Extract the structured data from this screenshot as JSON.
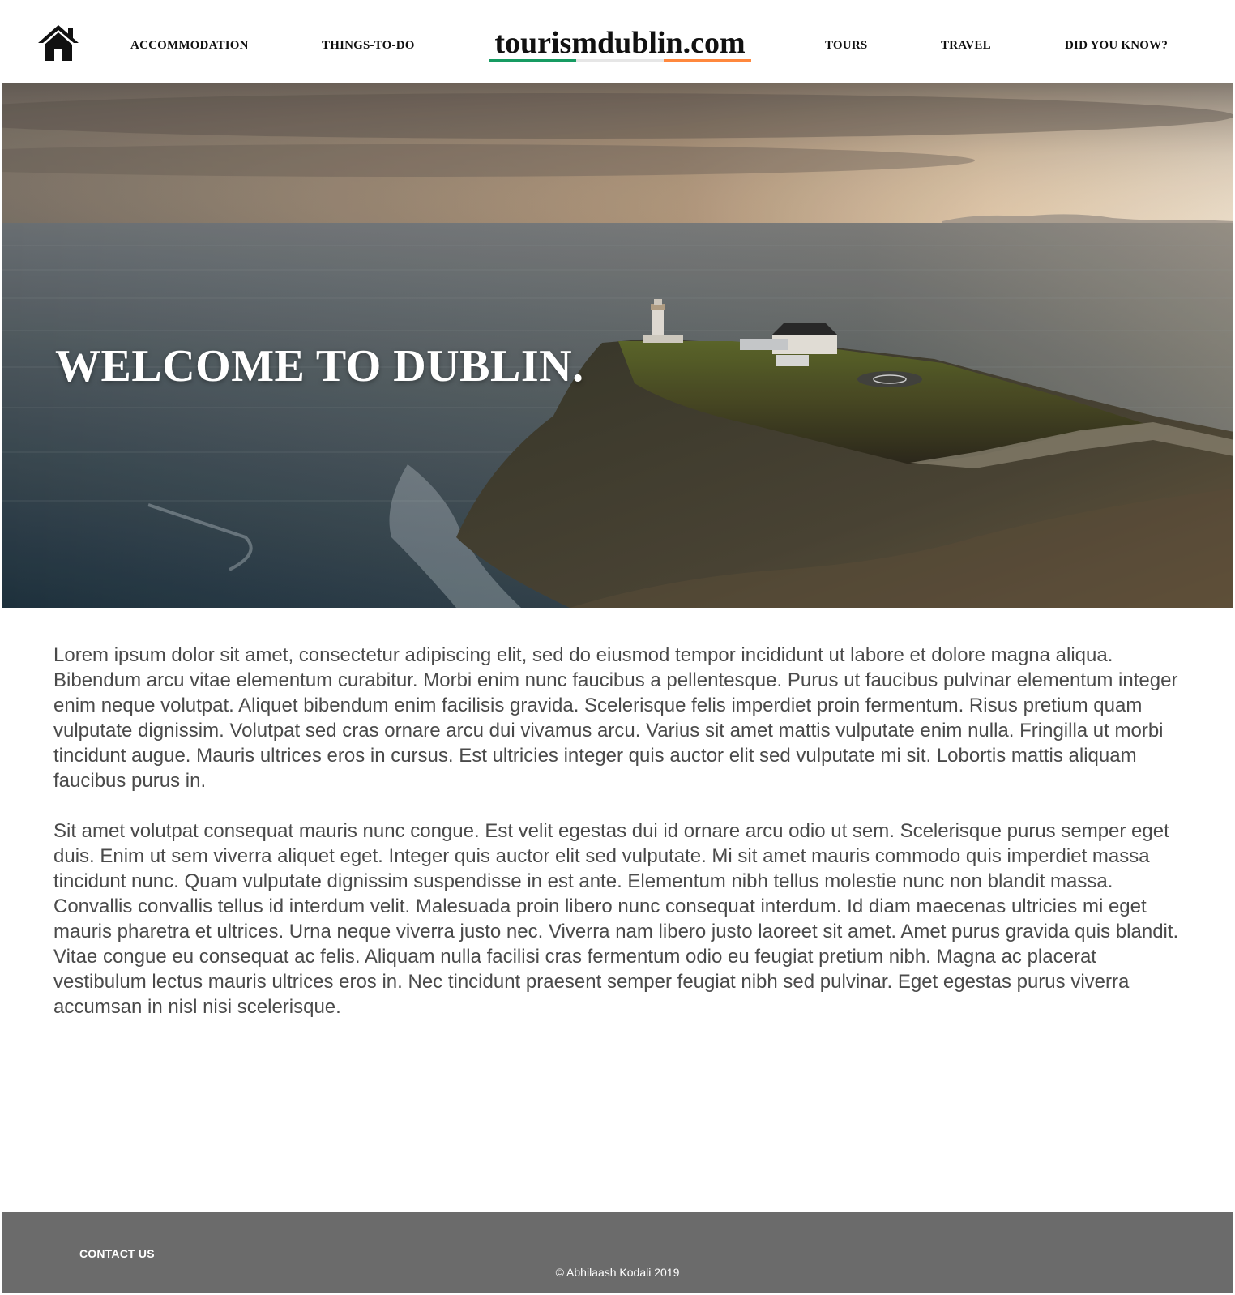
{
  "header": {
    "home_icon": "home-icon",
    "nav_left": [
      {
        "label": "ACCOMMODATION"
      },
      {
        "label": "THINGS-TO-DO"
      }
    ],
    "brand": "tourismdublin.com",
    "brand_underline_colors": [
      "#169b62",
      "#e6e6e6",
      "#ff883e"
    ],
    "nav_right": [
      {
        "label": "TOURS"
      },
      {
        "label": "TRAVEL"
      },
      {
        "label": "DID YOU KNOW?"
      }
    ]
  },
  "hero": {
    "title": "WELCOME TO DUBLIN.",
    "image": "coastal-lighthouse-photo"
  },
  "content": {
    "paragraphs": [
      "Lorem ipsum dolor sit amet, consectetur adipiscing elit, sed do eiusmod tempor incididunt ut labore et dolore magna aliqua. Bibendum arcu vitae elementum curabitur. Morbi enim nunc faucibus a pellentesque. Purus ut faucibus pulvinar elementum integer enim neque volutpat. Aliquet bibendum enim facilisis gravida. Scelerisque felis imperdiet proin fermentum. Risus pretium quam vulputate dignissim. Volutpat sed cras ornare arcu dui vivamus arcu. Varius sit amet mattis vulputate enim nulla. Fringilla ut morbi tincidunt augue. Mauris ultrices eros in cursus. Est ultricies integer quis auctor elit sed vulputate mi sit. Lobortis mattis aliquam faucibus purus in.",
      "Sit amet volutpat consequat mauris nunc congue. Est velit egestas dui id ornare arcu odio ut sem. Scelerisque purus semper eget duis. Enim ut sem viverra aliquet eget. Integer quis auctor elit sed vulputate. Mi sit amet mauris commodo quis imperdiet massa tincidunt nunc. Quam vulputate dignissim suspendisse in est ante. Elementum nibh tellus molestie nunc non blandit massa. Convallis convallis tellus id interdum velit. Malesuada proin libero nunc consequat interdum. Id diam maecenas ultricies mi eget mauris pharetra et ultrices. Urna neque viverra justo nec. Viverra nam libero justo laoreet sit amet. Amet purus gravida quis blandit. Vitae congue eu consequat ac felis. Aliquam nulla facilisi cras fermentum odio eu feugiat pretium nibh. Magna ac placerat vestibulum lectus mauris ultrices eros in. Nec tincidunt praesent semper feugiat nibh sed pulvinar. Eget egestas purus viverra accumsan in nisl nisi scelerisque."
    ]
  },
  "footer": {
    "contact": "CONTACT US",
    "copyright": "© Abhilaash Kodali 2019",
    "background": "#6b6b6b"
  }
}
